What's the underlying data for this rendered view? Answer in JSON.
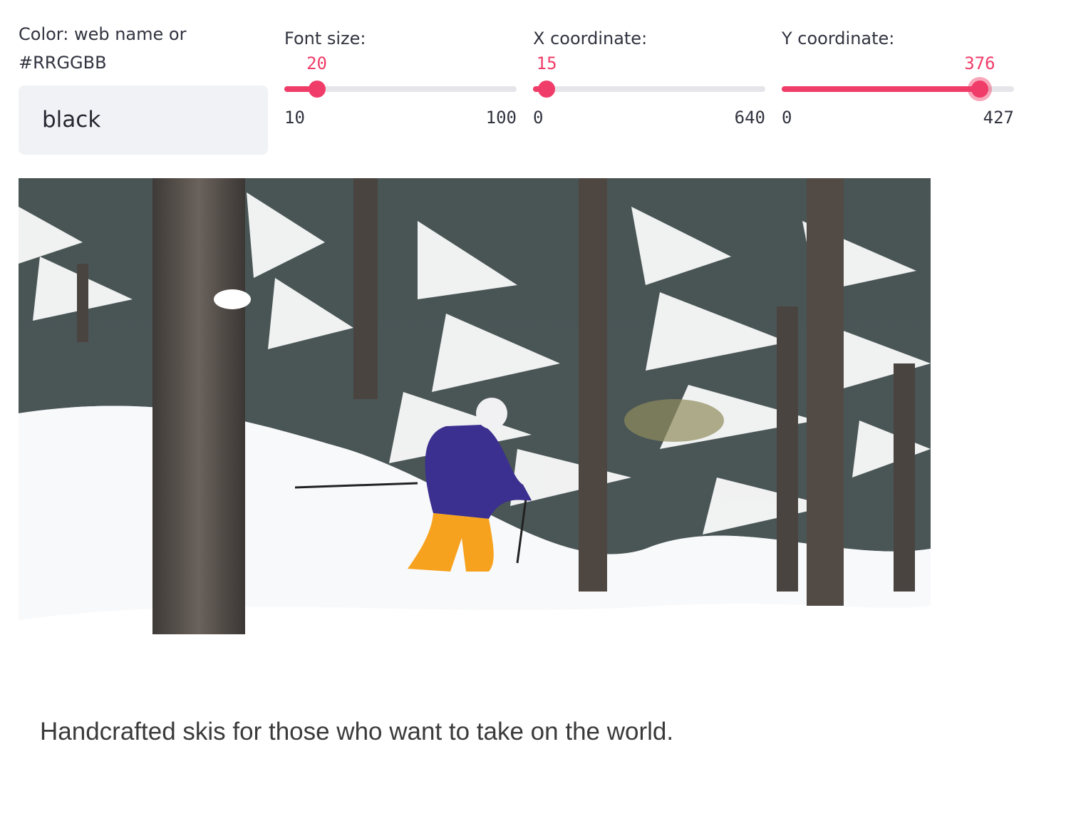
{
  "color_input": {
    "label": "Color: web name or #RRGGBB",
    "value": "black"
  },
  "sliders": [
    {
      "id": "font-size",
      "label": "Font size:",
      "value": 20,
      "min": 10,
      "max": 100
    },
    {
      "id": "x-coordinate",
      "label": "X coordinate:",
      "value": 15,
      "min": 0,
      "max": 640
    },
    {
      "id": "y-coordinate",
      "label": "Y coordinate:",
      "value": 376,
      "min": 0,
      "max": 427
    }
  ],
  "image": {
    "caption": "Handcrafted skis for those who want to take on the world."
  },
  "colors": {
    "accent": "#f03c69",
    "input_bg": "#f0f2f6",
    "track": "#e6e6ea"
  }
}
